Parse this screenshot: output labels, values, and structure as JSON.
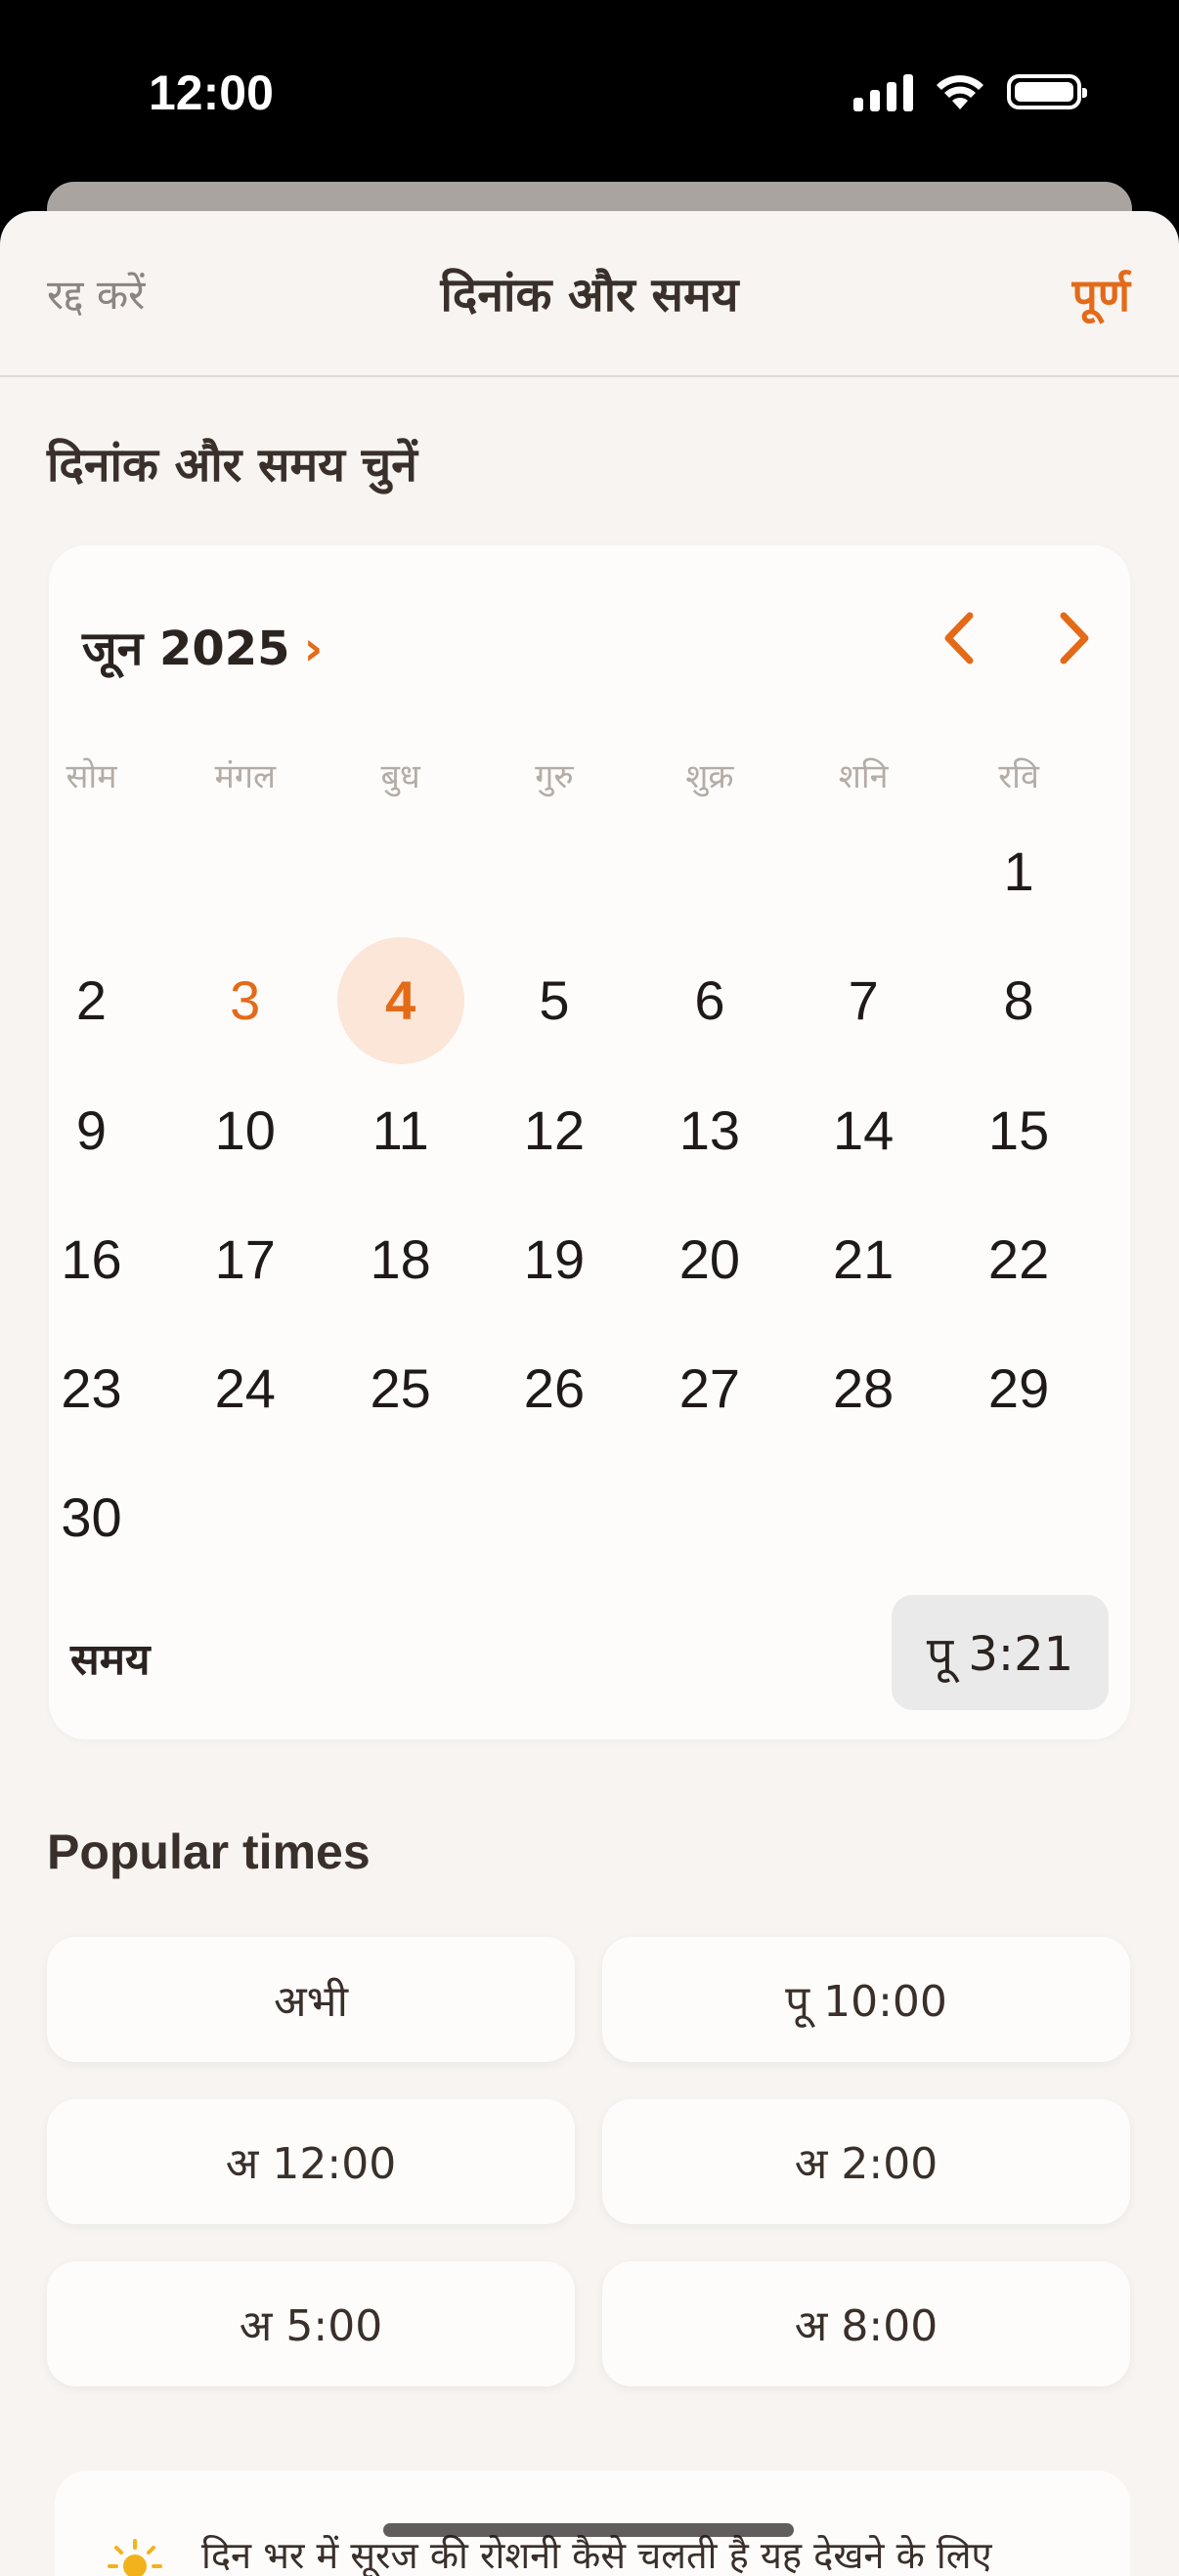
{
  "status_bar": {
    "time": "12:00"
  },
  "navbar": {
    "cancel": "रद्द करें",
    "title": "दिनांक और समय",
    "done": "पूर्ण"
  },
  "picker": {
    "section_title": "दिनांक और समय चुनें",
    "month_label": "जून 2025",
    "month_chevron": "›",
    "weekdays": [
      "सोम",
      "मंगल",
      "बुध",
      "गुरु",
      "शुक्र",
      "शनि",
      "रवि"
    ],
    "days": [
      "1",
      "2",
      "3",
      "4",
      "5",
      "6",
      "7",
      "8",
      "9",
      "10",
      "11",
      "12",
      "13",
      "14",
      "15",
      "16",
      "17",
      "18",
      "19",
      "20",
      "21",
      "22",
      "23",
      "24",
      "25",
      "26",
      "27",
      "28",
      "29",
      "30"
    ],
    "first_weekday_index": 6,
    "today": "3",
    "selected": "4",
    "time_label": "समय",
    "time_value": "पू 3:21"
  },
  "popular": {
    "title": "Popular times",
    "times": [
      "अभी",
      "पू 10:00",
      "अ 12:00",
      "अ 2:00",
      "अ 5:00",
      "अ 8:00"
    ]
  },
  "tip": {
    "text": "दिन भर में सूरज की रोशनी कैसे चलती है यह देखने के लिए"
  },
  "colors": {
    "accent": "#e46a18",
    "selected_bg": "#fbe6d7",
    "sheet_bg": "#f7f4f1"
  }
}
